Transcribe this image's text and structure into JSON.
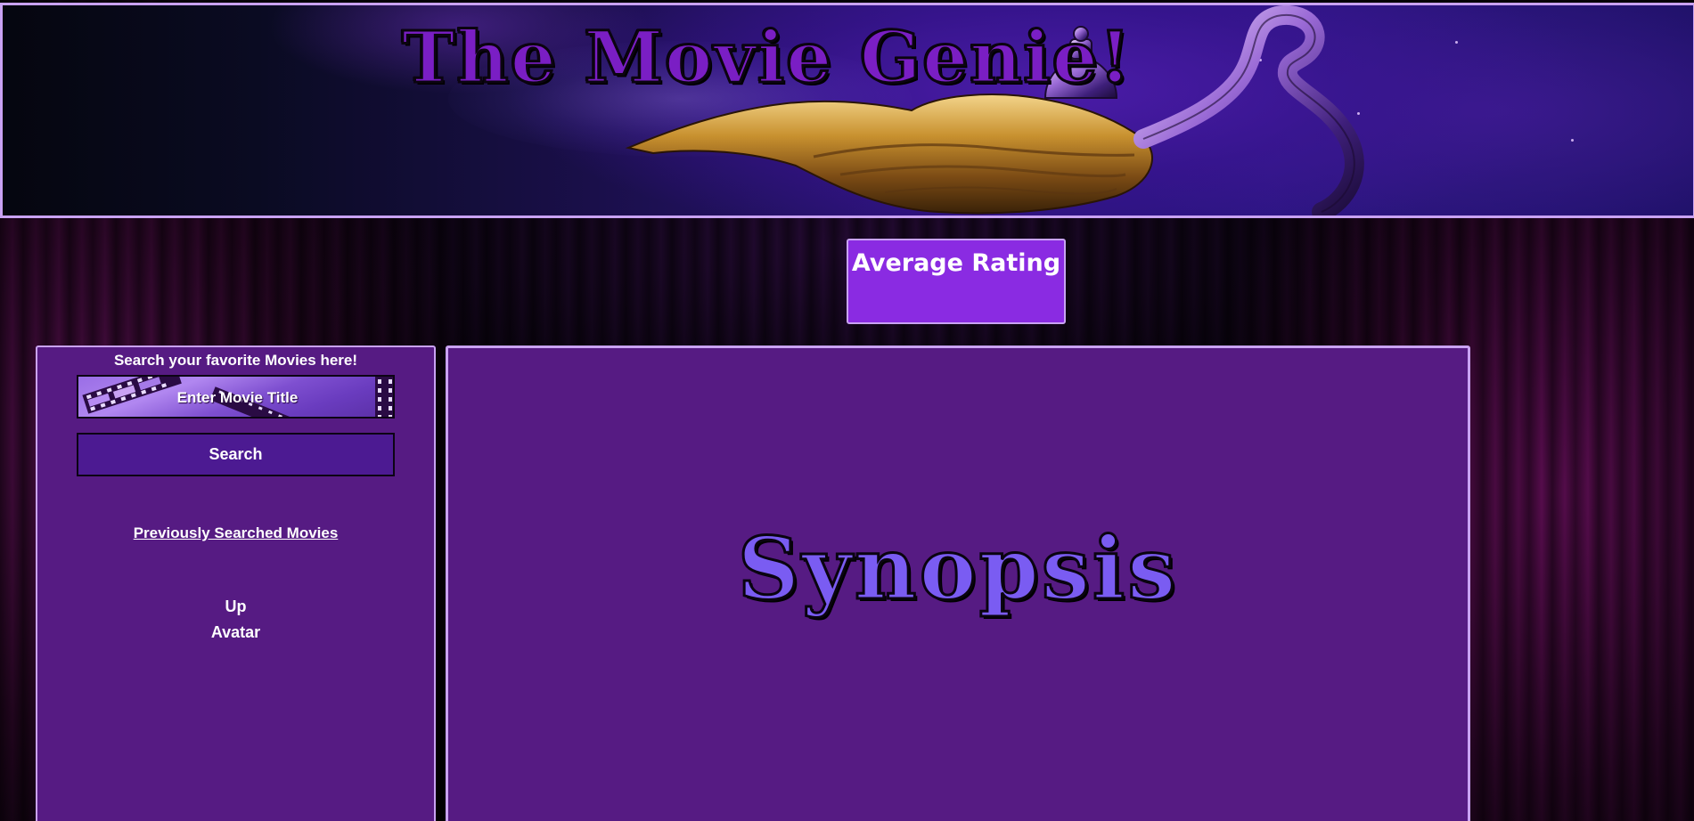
{
  "header": {
    "title": "The Movie Genie!"
  },
  "rating": {
    "title": "Average Rating",
    "value": ""
  },
  "search": {
    "heading": "Search your favorite Movies here!",
    "placeholder": "Enter Movie Title",
    "value": "",
    "button_label": "Search",
    "previous_heading": "Previously Searched Movies",
    "history": [
      "Up",
      "Avatar"
    ]
  },
  "synopsis": {
    "title": "Synopsis",
    "text": ""
  },
  "colors": {
    "panel": "#561b83",
    "border": "#c9a2f3",
    "rating_box": "#8a2be2",
    "search_button": "#4c1a92",
    "synopsis_title": "#7a5cf2",
    "banner_title": "#7a1ec4"
  },
  "icons": [
    "genie-lamp-icon",
    "film-strip-icon"
  ]
}
